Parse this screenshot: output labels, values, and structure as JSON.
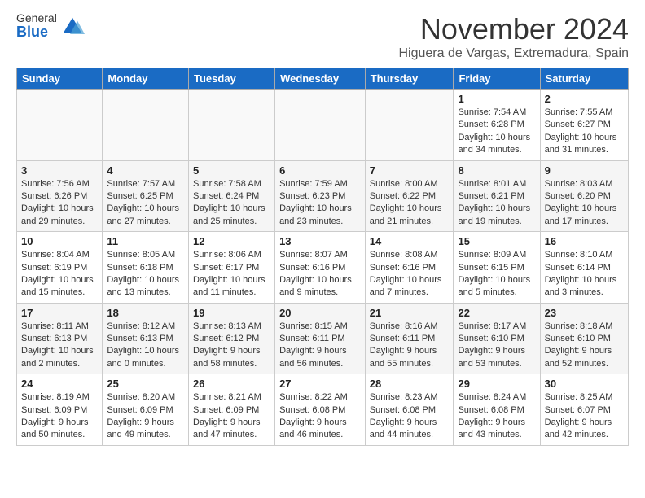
{
  "logo": {
    "general": "General",
    "blue": "Blue"
  },
  "header": {
    "month": "November 2024",
    "location": "Higuera de Vargas, Extremadura, Spain"
  },
  "weekdays": [
    "Sunday",
    "Monday",
    "Tuesday",
    "Wednesday",
    "Thursday",
    "Friday",
    "Saturday"
  ],
  "weeks": [
    [
      {
        "day": "",
        "info": ""
      },
      {
        "day": "",
        "info": ""
      },
      {
        "day": "",
        "info": ""
      },
      {
        "day": "",
        "info": ""
      },
      {
        "day": "",
        "info": ""
      },
      {
        "day": "1",
        "info": "Sunrise: 7:54 AM\nSunset: 6:28 PM\nDaylight: 10 hours and 34 minutes."
      },
      {
        "day": "2",
        "info": "Sunrise: 7:55 AM\nSunset: 6:27 PM\nDaylight: 10 hours and 31 minutes."
      }
    ],
    [
      {
        "day": "3",
        "info": "Sunrise: 7:56 AM\nSunset: 6:26 PM\nDaylight: 10 hours and 29 minutes."
      },
      {
        "day": "4",
        "info": "Sunrise: 7:57 AM\nSunset: 6:25 PM\nDaylight: 10 hours and 27 minutes."
      },
      {
        "day": "5",
        "info": "Sunrise: 7:58 AM\nSunset: 6:24 PM\nDaylight: 10 hours and 25 minutes."
      },
      {
        "day": "6",
        "info": "Sunrise: 7:59 AM\nSunset: 6:23 PM\nDaylight: 10 hours and 23 minutes."
      },
      {
        "day": "7",
        "info": "Sunrise: 8:00 AM\nSunset: 6:22 PM\nDaylight: 10 hours and 21 minutes."
      },
      {
        "day": "8",
        "info": "Sunrise: 8:01 AM\nSunset: 6:21 PM\nDaylight: 10 hours and 19 minutes."
      },
      {
        "day": "9",
        "info": "Sunrise: 8:03 AM\nSunset: 6:20 PM\nDaylight: 10 hours and 17 minutes."
      }
    ],
    [
      {
        "day": "10",
        "info": "Sunrise: 8:04 AM\nSunset: 6:19 PM\nDaylight: 10 hours and 15 minutes."
      },
      {
        "day": "11",
        "info": "Sunrise: 8:05 AM\nSunset: 6:18 PM\nDaylight: 10 hours and 13 minutes."
      },
      {
        "day": "12",
        "info": "Sunrise: 8:06 AM\nSunset: 6:17 PM\nDaylight: 10 hours and 11 minutes."
      },
      {
        "day": "13",
        "info": "Sunrise: 8:07 AM\nSunset: 6:16 PM\nDaylight: 10 hours and 9 minutes."
      },
      {
        "day": "14",
        "info": "Sunrise: 8:08 AM\nSunset: 6:16 PM\nDaylight: 10 hours and 7 minutes."
      },
      {
        "day": "15",
        "info": "Sunrise: 8:09 AM\nSunset: 6:15 PM\nDaylight: 10 hours and 5 minutes."
      },
      {
        "day": "16",
        "info": "Sunrise: 8:10 AM\nSunset: 6:14 PM\nDaylight: 10 hours and 3 minutes."
      }
    ],
    [
      {
        "day": "17",
        "info": "Sunrise: 8:11 AM\nSunset: 6:13 PM\nDaylight: 10 hours and 2 minutes."
      },
      {
        "day": "18",
        "info": "Sunrise: 8:12 AM\nSunset: 6:13 PM\nDaylight: 10 hours and 0 minutes."
      },
      {
        "day": "19",
        "info": "Sunrise: 8:13 AM\nSunset: 6:12 PM\nDaylight: 9 hours and 58 minutes."
      },
      {
        "day": "20",
        "info": "Sunrise: 8:15 AM\nSunset: 6:11 PM\nDaylight: 9 hours and 56 minutes."
      },
      {
        "day": "21",
        "info": "Sunrise: 8:16 AM\nSunset: 6:11 PM\nDaylight: 9 hours and 55 minutes."
      },
      {
        "day": "22",
        "info": "Sunrise: 8:17 AM\nSunset: 6:10 PM\nDaylight: 9 hours and 53 minutes."
      },
      {
        "day": "23",
        "info": "Sunrise: 8:18 AM\nSunset: 6:10 PM\nDaylight: 9 hours and 52 minutes."
      }
    ],
    [
      {
        "day": "24",
        "info": "Sunrise: 8:19 AM\nSunset: 6:09 PM\nDaylight: 9 hours and 50 minutes."
      },
      {
        "day": "25",
        "info": "Sunrise: 8:20 AM\nSunset: 6:09 PM\nDaylight: 9 hours and 49 minutes."
      },
      {
        "day": "26",
        "info": "Sunrise: 8:21 AM\nSunset: 6:09 PM\nDaylight: 9 hours and 47 minutes."
      },
      {
        "day": "27",
        "info": "Sunrise: 8:22 AM\nSunset: 6:08 PM\nDaylight: 9 hours and 46 minutes."
      },
      {
        "day": "28",
        "info": "Sunrise: 8:23 AM\nSunset: 6:08 PM\nDaylight: 9 hours and 44 minutes."
      },
      {
        "day": "29",
        "info": "Sunrise: 8:24 AM\nSunset: 6:08 PM\nDaylight: 9 hours and 43 minutes."
      },
      {
        "day": "30",
        "info": "Sunrise: 8:25 AM\nSunset: 6:07 PM\nDaylight: 9 hours and 42 minutes."
      }
    ]
  ]
}
